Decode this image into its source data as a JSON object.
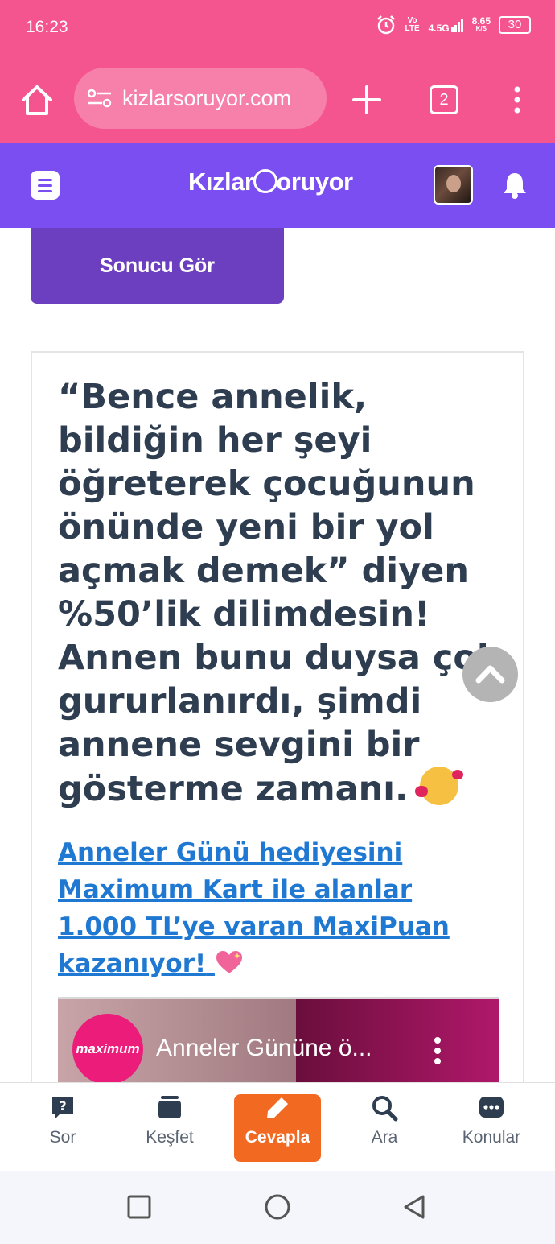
{
  "status": {
    "time": "16:23",
    "volte": "Vo LTE",
    "network": "4.5G",
    "speed": "8.65",
    "speed_unit": "K/S",
    "battery": "30"
  },
  "browser": {
    "url": "kizlarsoruyor.com",
    "tab_count": "2"
  },
  "site": {
    "logo_text_1": "Kızlar",
    "logo_text_2": "S",
    "logo_text_3": "oruyor"
  },
  "main": {
    "result_button": "Sonucu Gör",
    "quote": "“Bence annelik, bildiğin her şeyi öğreterek çocuğunun önünde yeni bir yol açmak demek” diyen %50’lik dilimdesin! Annen bunu duysa çok gururlanırdı, şimdi annene sevgini bir gösterme zamanı.",
    "promo_link": "Anneler Günü hediyesini Maximum Kart ile alanlar 1.000 TL’ye varan MaxiPuan kazanıyor!",
    "video": {
      "channel_logo": "maximum",
      "title": "Anneler Gününe ö..."
    }
  },
  "bottom_nav": [
    {
      "label": "Sor",
      "icon": "question-bubble-icon"
    },
    {
      "label": "Keşfet",
      "icon": "cards-icon"
    },
    {
      "label": "Cevapla",
      "icon": "pencil-icon",
      "active": true
    },
    {
      "label": "Ara",
      "icon": "search-icon"
    },
    {
      "label": "Konular",
      "icon": "chat-dots-icon"
    }
  ],
  "colors": {
    "browser_bar": "#f4558f",
    "site_header": "#7a4ef0",
    "result_button": "#6b3fbf",
    "active_nav": "#f26a21",
    "link": "#1f78d1"
  }
}
